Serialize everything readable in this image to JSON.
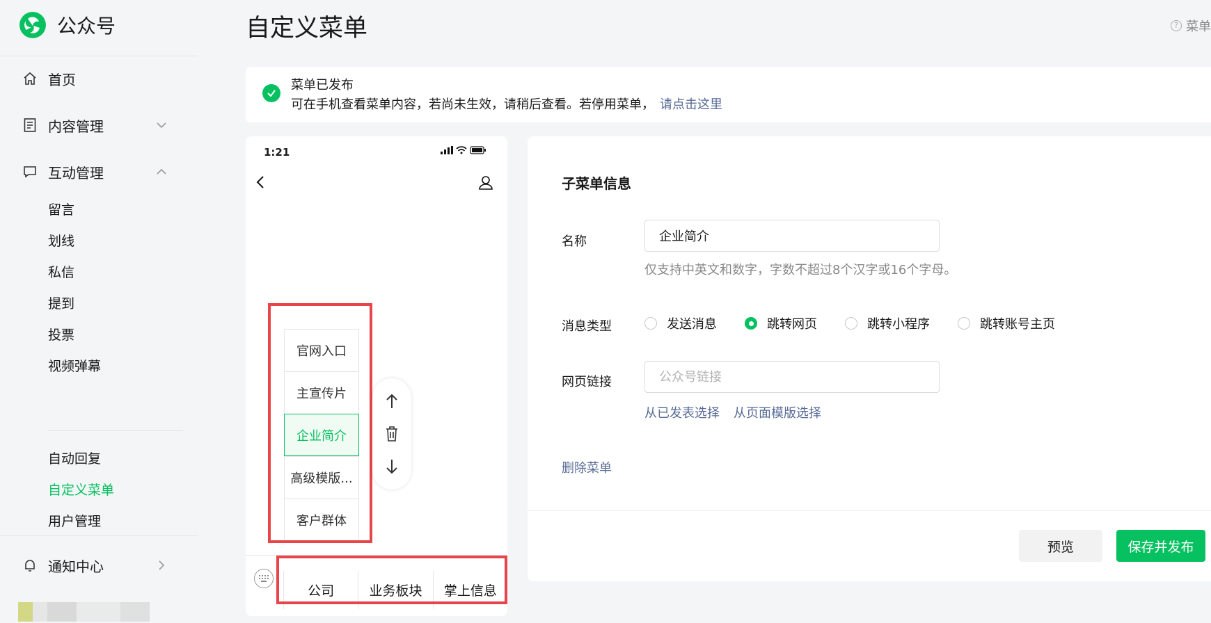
{
  "sidebar": {
    "brand": "公众号",
    "items": [
      {
        "label": "首页",
        "icon": "home-icon"
      },
      {
        "label": "内容管理",
        "icon": "document-icon",
        "expanded": false
      },
      {
        "label": "互动管理",
        "icon": "chat-icon",
        "expanded": true
      }
    ],
    "interaction_sub": [
      "留言",
      "划线",
      "私信",
      "提到",
      "投票",
      "视频弹幕"
    ],
    "other_sub": [
      "自动回复",
      "自定义菜单",
      "用户管理"
    ],
    "active_sub": "自定义菜单",
    "notice_center": {
      "label": "通知中心",
      "icon": "bell-icon"
    }
  },
  "header": {
    "title": "自定义菜单",
    "help_label": "菜单"
  },
  "notice": {
    "title": "菜单已发布",
    "body": "可在手机查看菜单内容，若尚未生效，请稍后查看。若停用菜单，",
    "link": "请点击这里"
  },
  "phone": {
    "time": "1:21",
    "submenu": [
      "官网入口",
      "主宣传片",
      "企业简介",
      "高级模版...",
      "客户群体"
    ],
    "selected_submenu": "企业简介",
    "mainmenu": [
      "公司",
      "业务板块",
      "掌上信息"
    ]
  },
  "form": {
    "title": "子菜单信息",
    "name_label": "名称",
    "name_value": "企业简介",
    "name_hint": "仅支持中英文和数字，字数不超过8个汉字或16个字母。",
    "type_label": "消息类型",
    "types": [
      "发送消息",
      "跳转网页",
      "跳转小程序",
      "跳转账号主页"
    ],
    "selected_type": "跳转网页",
    "url_label": "网页链接",
    "url_placeholder": "公众号链接",
    "link_published": "从已发表选择",
    "link_template": "从页面模版选择",
    "delete_label": "删除菜单",
    "preview_label": "预览",
    "publish_label": "保存并发布"
  },
  "colors": {
    "accent": "#07c160",
    "link": "#576b95",
    "highlight_border": "#e8454b"
  }
}
